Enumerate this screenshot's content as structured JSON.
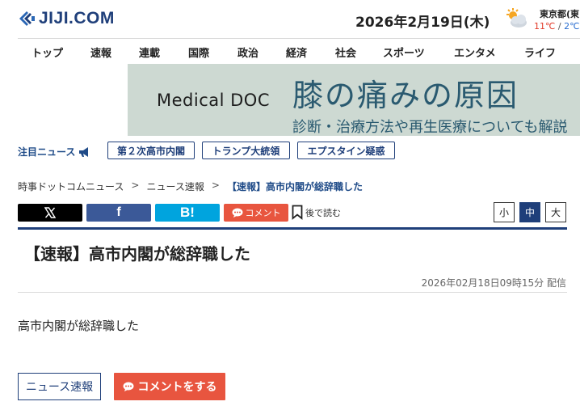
{
  "header": {
    "logo_text": "JIJI.COM",
    "date": "2026年2月19日(木)",
    "weather": {
      "icon": "sun-behind-cloud-icon",
      "city": "東京都(東",
      "temp_high": "11℃",
      "separator": "/",
      "temp_low": "2℃"
    }
  },
  "nav": {
    "items": [
      "トップ",
      "速報",
      "連載",
      "国際",
      "政治",
      "経済",
      "社会",
      "スポーツ",
      "エンタメ",
      "ライフ"
    ]
  },
  "banner": {
    "brand": "Medical DOC",
    "title": "膝の痛みの原因",
    "subtitle": "診断・治療方法や再生医療についても解説"
  },
  "trending": {
    "label": "注目ニュース",
    "tags": [
      "第２次高市内閣",
      "トランプ大統領",
      "エプスタイン疑惑"
    ]
  },
  "breadcrumb": {
    "items": [
      "時事ドットコムニュース",
      "ニュース速報",
      "【速報】高市内閣が総辞職した"
    ],
    "separator": ">"
  },
  "share": {
    "x_icon": "x-logo-icon",
    "facebook_label": "f",
    "hatena_label": "B!",
    "comment_label": "コメント",
    "read_later_label": "後で読む"
  },
  "font_size": {
    "small": "小",
    "medium": "中",
    "large": "大",
    "selected": "中"
  },
  "article": {
    "headline": "【速報】高市内閣が総辞職した",
    "published": "2026年02月18日09時15分 配信",
    "body": "高市内閣が総辞職した",
    "category_button": "ニュース速報",
    "comment_button": "コメントをする"
  },
  "colors": {
    "brand_navy": "#1f3f7a",
    "comment_orange": "#e8553f",
    "facebook_blue": "#3b5998",
    "hatena_blue": "#00a4de",
    "temp_high": "#e23b2a",
    "temp_low": "#2a6ed0"
  }
}
